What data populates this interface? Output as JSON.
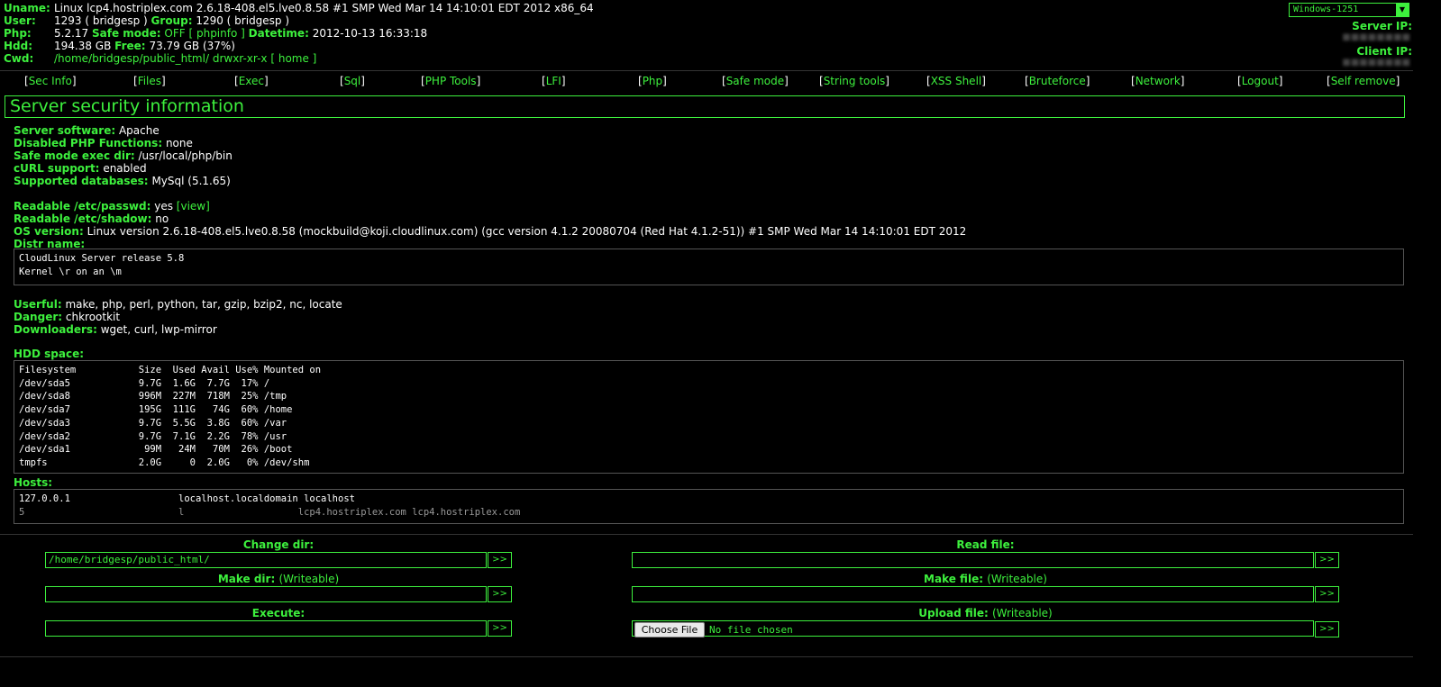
{
  "header": {
    "uname_label": "Uname:",
    "uname_value": "Linux lcp4.hostriplex.com 2.6.18-408.el5.lve0.8.58 #1 SMP Wed Mar 14 14:10:01 EDT 2012 x86_64",
    "user_label": "User:",
    "user_value": "1293 ( bridgesp )",
    "group_label": "Group:",
    "group_value": "1290 ( bridgesp )",
    "php_label": "Php:",
    "php_value": "5.2.17",
    "safe_mode_label": "Safe mode:",
    "safe_mode_value": "OFF",
    "phpinfo_link": "[ phpinfo ]",
    "datetime_label": "Datetime:",
    "datetime_value": "2012-10-13 16:33:18",
    "hdd_label": "Hdd:",
    "hdd_value": "194.38 GB",
    "free_label": "Free:",
    "free_value": "73.79 GB (37%)",
    "cwd_label": "Cwd:",
    "cwd_path": "/home/bridgesp/public_html/",
    "cwd_perms": "drwxr-xr-x",
    "home_link": "[ home ]",
    "charset": "Windows-1251",
    "server_ip_label": "Server IP:",
    "client_ip_label": "Client IP:"
  },
  "menu": [
    "Sec Info",
    "Files",
    "Exec",
    "Sql",
    "PHP Tools",
    "LFI",
    "Php",
    "Safe mode",
    "String tools",
    "XSS Shell",
    "Bruteforce",
    "Network",
    "Logout",
    "Self remove"
  ],
  "section_title": "Server security information",
  "info": {
    "server_software_label": "Server software:",
    "server_software": "Apache",
    "disabled_php_label": "Disabled PHP Functions:",
    "disabled_php": "none",
    "safe_exec_label": "Safe mode exec dir:",
    "safe_exec": "/usr/local/php/bin",
    "curl_label": "cURL support:",
    "curl": "enabled",
    "databases_label": "Supported databases:",
    "databases": "MySql (5.1.65)",
    "passwd_label": "Readable /etc/passwd:",
    "passwd": "yes",
    "passwd_link": "[view]",
    "shadow_label": "Readable /etc/shadow:",
    "shadow": "no",
    "os_label": "OS version:",
    "os": "Linux version 2.6.18-408.el5.lve0.8.58 (mockbuild@koji.cloudlinux.com) (gcc version 4.1.2 20080704 (Red Hat 4.1.2-51)) #1 SMP Wed Mar 14 14:10:01 EDT 2012",
    "distr_label": "Distr name:",
    "distr_lines": [
      "CloudLinux Server release 5.8",
      "Kernel \\r on an \\m"
    ],
    "userful_label": "Userful:",
    "userful": "make, php, perl, python, tar, gzip, bzip2, nc, locate",
    "danger_label": "Danger:",
    "danger": "chkrootkit",
    "downloaders_label": "Downloaders:",
    "downloaders": "wget, curl, lwp-mirror",
    "hdd_space_label": "HDD space:",
    "hdd_space_lines": [
      "Filesystem           Size  Used Avail Use% Mounted on",
      "/dev/sda5            9.7G  1.6G  7.7G  17% /",
      "/dev/sda8            996M  227M  718M  25% /tmp",
      "/dev/sda7            195G  111G   74G  60% /home",
      "/dev/sda3            9.7G  5.5G  3.8G  60% /var",
      "/dev/sda2            9.7G  7.1G  2.2G  78% /usr",
      "/dev/sda1             99M   24M   70M  26% /boot",
      "tmpfs                2.0G     0  2.0G   0% /dev/shm"
    ],
    "hosts_label": "Hosts:",
    "hosts_lines": [
      "127.0.0.1                   localhost.localdomain localhost",
      "5                           l                    lcp4.hostriplex.com lcp4.hostriplex.com"
    ]
  },
  "forms": {
    "change_dir_label": "Change dir:",
    "change_dir_value": "/home/bridgesp/public_html/",
    "read_file_label": "Read file:",
    "make_dir_label": "Make dir:",
    "make_dir_note": "(Writeable)",
    "make_file_label": "Make file:",
    "make_file_note": "(Writeable)",
    "execute_label": "Execute:",
    "upload_file_label": "Upload file:",
    "upload_file_note": "(Writeable)",
    "submit_label": ">>",
    "choose_file_label": "Choose File",
    "no_file_text": "No file chosen"
  },
  "colors": {
    "accent": "#3df03d",
    "background": "#000000",
    "text": "#ffffff"
  }
}
